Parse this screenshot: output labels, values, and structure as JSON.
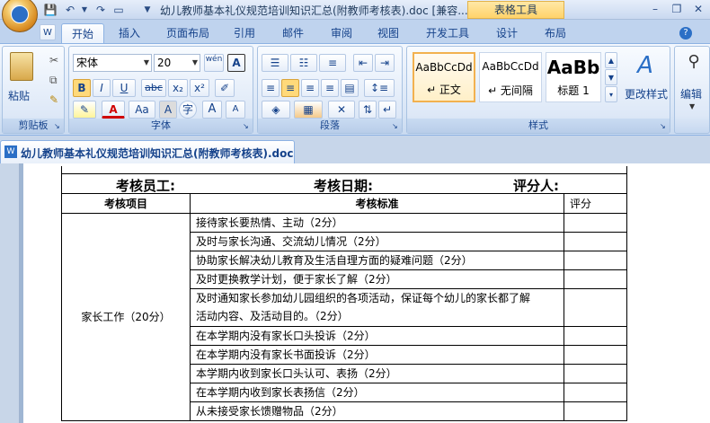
{
  "titlebar": {
    "title": "幼儿教师基本礼仪规范培训知识汇总(附教师考核表).doc [兼容...",
    "context_tab": "表格工具",
    "customize_glyph": "▼"
  },
  "tabs": [
    "开始",
    "插入",
    "页面布局",
    "引用",
    "邮件",
    "审阅",
    "视图",
    "开发工具",
    "设计",
    "布局"
  ],
  "ribbon": {
    "clipboard": {
      "label": "剪贴板",
      "paste": "粘贴"
    },
    "font": {
      "label": "字体",
      "font_name": "宋体",
      "font_size": "20",
      "bold": "B",
      "italic": "I",
      "underline": "U",
      "strike": "abc",
      "sub": "x₂",
      "sup": "x²",
      "grow": "A",
      "shrink": "A",
      "aa": "Aa",
      "wen": "wén",
      "A_box": "A",
      "A_red": "A",
      "A_char": "A",
      "zi": "字",
      "A_circle": "A"
    },
    "paragraph": {
      "label": "段落"
    },
    "styles": {
      "label": "样式",
      "cards": [
        {
          "sample": "AaBbCcDd",
          "name": "↵ 正文"
        },
        {
          "sample": "AaBbCcDd",
          "name": "↵ 无间隔"
        },
        {
          "sample": "AaBb",
          "name": "标题 1"
        }
      ],
      "change": "更改样式"
    },
    "editing": {
      "label": "编辑"
    }
  },
  "document": {
    "tab_label": "幼儿教师基本礼仪规范培训知识汇总(附教师考核表).doc",
    "table": {
      "row1": {
        "employee": "考核员工:",
        "date": "考核日期:",
        "rater": "评分人:"
      },
      "headers": {
        "item": "考核项目",
        "standard": "考核标准",
        "score": "评分"
      },
      "category": "家长工作（20分）",
      "criteria": [
        "接待家长要热情、主动（2分）",
        "及时与家长沟通、交流幼儿情况（2分）",
        "协助家长解决幼儿教育及生活自理方面的疑难问题（2分）",
        "及时更换教学计划，便于家长了解（2分）",
        "及时通知家长参加幼儿园组织的各项活动，保证每个幼儿的家长都了解",
        "活动内容、及活动目的。（2分）",
        "在本学期内没有家长口头投诉（2分）",
        "在本学期内没有家长书面投诉（2分）",
        "本学期内收到家长口头认可、表扬（2分）",
        "在本学期内收到家长表扬信（2分）",
        "从未接受家长馈赠物品（2分）"
      ]
    }
  }
}
